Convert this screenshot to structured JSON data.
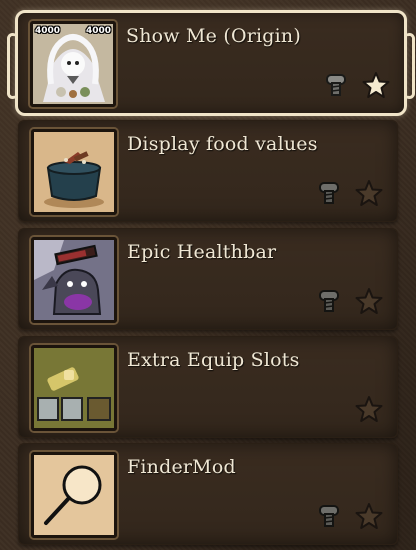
{
  "mods": [
    {
      "title": "Show Me (Origin)",
      "selected": true,
      "thumb_stats": [
        "4000",
        "4000"
      ],
      "icons": [
        "screw-icon",
        "star-icon-filled"
      ]
    },
    {
      "title": "Display food values",
      "selected": false,
      "icons": [
        "screw-icon",
        "star-icon-outline"
      ]
    },
    {
      "title": "Epic Healthbar",
      "selected": false,
      "icons": [
        "screw-icon",
        "star-icon-outline"
      ]
    },
    {
      "title": "Extra Equip Slots",
      "selected": false,
      "icons": [
        "star-icon-outline"
      ]
    },
    {
      "title": "FinderMod",
      "selected": false,
      "icons": [
        "screw-icon",
        "star-icon-outline"
      ]
    }
  ],
  "colors": {
    "frame": "#f0e4c8",
    "star_filled": "#f4ead0",
    "text": "#efe7d4"
  }
}
